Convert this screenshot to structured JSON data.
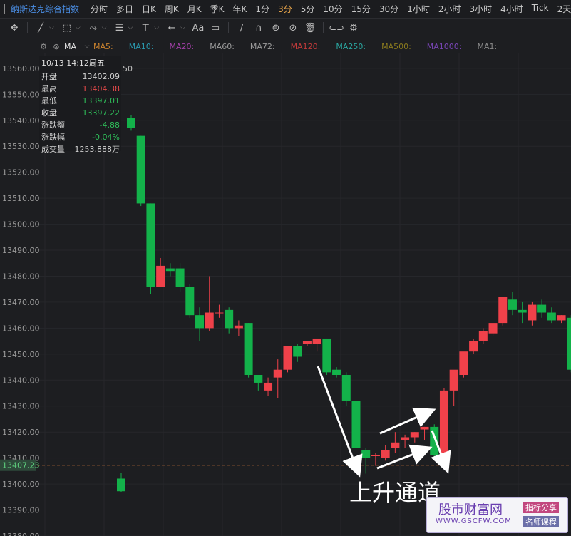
{
  "header": {
    "index_title": "纳斯达克综合指数",
    "periods": [
      "分时",
      "多日",
      "日K",
      "周K",
      "月K",
      "季K",
      "年K",
      "1分",
      "3分",
      "5分",
      "10分",
      "15分",
      "30分",
      "1小时",
      "2小时",
      "3小时",
      "4小时",
      "Tick",
      "2天"
    ],
    "active_period": "3分"
  },
  "toolbar": {
    "font_label": "Aa"
  },
  "ma_bar": {
    "indicator": "MA",
    "items": [
      {
        "label": "MA5:",
        "color": "#c9822e"
      },
      {
        "label": "MA10:",
        "color": "#2a9bb0"
      },
      {
        "label": "MA20:",
        "color": "#a13fa6"
      },
      {
        "label": "MA60:",
        "color": "#9a9a9a"
      },
      {
        "label": "MA72:",
        "color": "#9a9a9a"
      },
      {
        "label": "MA120:",
        "color": "#c03a3a"
      },
      {
        "label": "MA250:",
        "color": "#2aa6a0"
      },
      {
        "label": "MA500:",
        "color": "#8a7a1e"
      },
      {
        "label": "MA1000:",
        "color": "#7a46b8"
      },
      {
        "label": "MA1:",
        "color": "#8a8a8a"
      }
    ]
  },
  "info_panel": {
    "datetime": "10/13 14:12周五",
    "rows": [
      {
        "key": "开盘",
        "value": "13402.09",
        "color": "#cfcfcf"
      },
      {
        "key": "最高",
        "value": "13404.38",
        "color": "#e84a4a"
      },
      {
        "key": "最低",
        "value": "13397.01",
        "color": "#2fbf5a"
      },
      {
        "key": "收盘",
        "value": "13397.22",
        "color": "#2fbf5a"
      },
      {
        "key": "涨跌额",
        "value": "-4.88",
        "color": "#2fbf5a"
      },
      {
        "key": "涨跌幅",
        "value": "-0.04%",
        "color": "#2fbf5a"
      },
      {
        "key": "成交量",
        "value": "1253.888万",
        "color": "#cfcfcf"
      }
    ]
  },
  "chart_data": {
    "type": "candlestick",
    "ylim": [
      13380,
      13566
    ],
    "y_ticks": [
      "13560.00",
      "13550.00",
      "13540.00",
      "13530.00",
      "13520.00",
      "13510.00",
      "13500.00",
      "13490.00",
      "13480.00",
      "13470.00",
      "13460.00",
      "13450.00",
      "13440.00",
      "13430.00",
      "13420.00",
      "13410.00",
      "13400.00",
      "13390.00",
      "13380.00"
    ],
    "y_tick_values": [
      13560,
      13550,
      13540,
      13530,
      13520,
      13510,
      13500,
      13490,
      13480,
      13470,
      13460,
      13450,
      13440,
      13430,
      13420,
      13410,
      13400,
      13390,
      13380
    ],
    "current_price": 13407.23,
    "current_price_label": "13407.23",
    "partial_label": "50",
    "up_color": "#f0414a",
    "down_color": "#13b24a",
    "candles": [
      {
        "o": 13402.09,
        "h": 13404.38,
        "c": 13397.22,
        "l": 13397.01
      },
      {
        "o": 13541,
        "h": 13542,
        "c": 13537,
        "l": 13536
      },
      {
        "o": 13534,
        "h": 13534,
        "c": 13508,
        "l": 13507
      },
      {
        "o": 13508,
        "h": 13508,
        "c": 13476,
        "l": 13473
      },
      {
        "o": 13476,
        "h": 13487,
        "c": 13484,
        "l": 13476
      },
      {
        "o": 13483,
        "h": 13485,
        "c": 13482,
        "l": 13480
      },
      {
        "o": 13483,
        "h": 13485,
        "c": 13476,
        "l": 13474
      },
      {
        "o": 13476,
        "h": 13477,
        "c": 13465,
        "l": 13464
      },
      {
        "o": 13465,
        "h": 13468,
        "c": 13460,
        "l": 13455
      },
      {
        "o": 13460,
        "h": 13480,
        "c": 13466,
        "l": 13459
      },
      {
        "o": 13466,
        "h": 13469,
        "c": 13466,
        "l": 13464
      },
      {
        "o": 13467,
        "h": 13468,
        "c": 13460,
        "l": 13458
      },
      {
        "o": 13460,
        "h": 13463,
        "c": 13461,
        "l": 13457
      },
      {
        "o": 13462,
        "h": 13462,
        "c": 13442,
        "l": 13441
      },
      {
        "o": 13442,
        "h": 13442,
        "c": 13439,
        "l": 13436
      },
      {
        "o": 13436,
        "h": 13441,
        "c": 13439,
        "l": 13434
      },
      {
        "o": 13441,
        "h": 13448,
        "c": 13444,
        "l": 13433
      },
      {
        "o": 13444,
        "h": 13450,
        "c": 13453,
        "l": 13443
      },
      {
        "o": 13453,
        "h": 13454,
        "c": 13449,
        "l": 13447
      },
      {
        "o": 13454,
        "h": 13455,
        "c": 13455,
        "l": 13453
      },
      {
        "o": 13454,
        "h": 13456,
        "c": 13456,
        "l": 13451
      },
      {
        "o": 13456,
        "h": 13456,
        "c": 13443,
        "l": 13442
      },
      {
        "o": 13444,
        "h": 13445,
        "c": 13442,
        "l": 13441
      },
      {
        "o": 13442,
        "h": 13443,
        "c": 13432,
        "l": 13430
      },
      {
        "o": 13432,
        "h": 13432,
        "c": 13414,
        "l": 13413
      },
      {
        "o": 13413,
        "h": 13414,
        "c": 13410,
        "l": 13404
      },
      {
        "o": 13411,
        "h": 13412,
        "c": 13411,
        "l": 13407
      },
      {
        "o": 13410,
        "h": 13415,
        "c": 13413,
        "l": 13409
      },
      {
        "o": 13414,
        "h": 13420,
        "c": 13416,
        "l": 13412
      },
      {
        "o": 13417,
        "h": 13419,
        "c": 13418,
        "l": 13414
      },
      {
        "o": 13418,
        "h": 13420,
        "c": 13420,
        "l": 13416
      },
      {
        "o": 13421,
        "h": 13422,
        "c": 13422,
        "l": 13417
      },
      {
        "o": 13422,
        "h": 13423,
        "c": 13411,
        "l": 13410
      },
      {
        "o": 13412,
        "h": 13437,
        "c": 13436,
        "l": 13411
      },
      {
        "o": 13436,
        "h": 13441,
        "c": 13444,
        "l": 13430
      },
      {
        "o": 13442,
        "h": 13450,
        "c": 13451,
        "l": 13441
      },
      {
        "o": 13451,
        "h": 13456,
        "c": 13455,
        "l": 13450
      },
      {
        "o": 13455,
        "h": 13460,
        "c": 13459,
        "l": 13454
      },
      {
        "o": 13458,
        "h": 13462,
        "c": 13462,
        "l": 13457
      },
      {
        "o": 13462,
        "h": 13472,
        "c": 13472,
        "l": 13461
      },
      {
        "o": 13471,
        "h": 13474,
        "c": 13467,
        "l": 13465
      },
      {
        "o": 13467,
        "h": 13470,
        "c": 13466,
        "l": 13462
      },
      {
        "o": 13463,
        "h": 13470,
        "c": 13469,
        "l": 13461
      },
      {
        "o": 13469,
        "h": 13471,
        "c": 13466,
        "l": 13464
      },
      {
        "o": 13466,
        "h": 13468,
        "c": 13463,
        "l": 13462
      },
      {
        "o": 13463,
        "h": 13465,
        "c": 13465,
        "l": 13462
      },
      {
        "o": 13464,
        "h": 13465,
        "c": 13444,
        "l": 13443
      }
    ],
    "annotation_text": "上升通道"
  },
  "watermark": {
    "logo": "股市财富网",
    "url": "WWW.GSCFW.COM",
    "tag1": "指标分享",
    "tag2": "名师课程"
  }
}
